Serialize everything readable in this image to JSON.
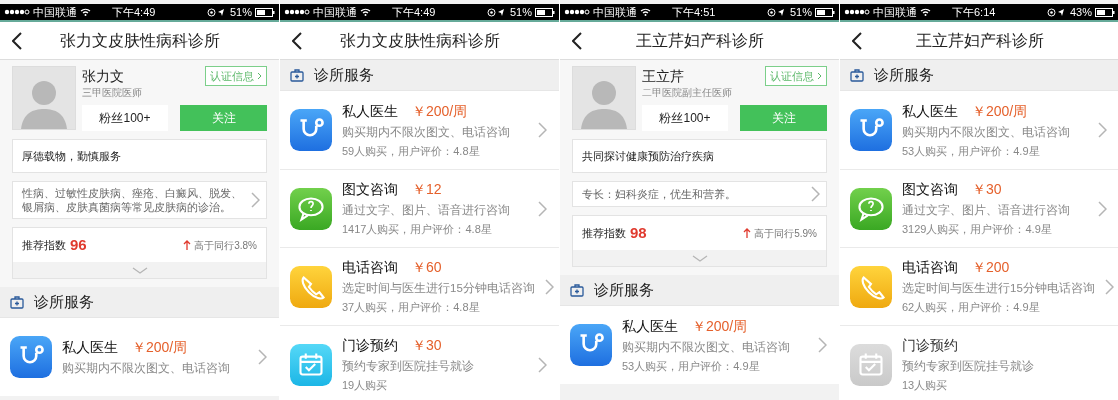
{
  "screens": [
    {
      "status_bar": {
        "carrier": "中国联通",
        "time": "下午4:49",
        "battery": "51%"
      },
      "nav": {
        "title": "张力文皮肤性病科诊所"
      },
      "doctor": {
        "name": "张力文",
        "title": "三甲医院医师",
        "verify": "认证信息",
        "fans": "粉丝100+",
        "follow": "关注",
        "motto": "厚德载物，勤慎服务",
        "specialty": "性病、过敏性皮肤病、痤疮、白癜风、脱发、银屑病、皮肤真菌病等常见皮肤病的诊治。",
        "rating_label": "推荐指数",
        "rating": "96",
        "compare": "高于同行3.8%"
      },
      "section": "诊所服务",
      "services": [
        {
          "kind": "doctor",
          "name": "私人医生",
          "price": "￥200/周",
          "desc": "购买期内不限次图文、电话咨询",
          "disabled": false
        }
      ]
    },
    {
      "status_bar": {
        "carrier": "中国联通",
        "time": "下午4:49",
        "battery": "51%"
      },
      "nav": {
        "title": "张力文皮肤性病科诊所"
      },
      "section": "诊所服务",
      "services": [
        {
          "kind": "doctor",
          "name": "私人医生",
          "price": "￥200/周",
          "desc": "购买期内不限次图文、电话咨询",
          "stats": "59人购买，用户评价：4.8星",
          "disabled": false
        },
        {
          "kind": "chat",
          "name": "图文咨询",
          "price": "￥12",
          "desc": "通过文字、图片、语音进行咨询",
          "stats": "1417人购买，用户评价：4.8星",
          "disabled": false
        },
        {
          "kind": "phone",
          "name": "电话咨询",
          "price": "￥60",
          "desc": "选定时间与医生进行15分钟电话咨询",
          "stats": "37人购买，用户评价：4.8星",
          "disabled": false
        },
        {
          "kind": "calendar",
          "name": "门诊预约",
          "price": "￥30",
          "desc": "预约专家到医院挂号就诊",
          "stats": "19人购买",
          "disabled": false
        }
      ]
    },
    {
      "status_bar": {
        "carrier": "中国联通",
        "time": "下午4:51",
        "battery": "51%"
      },
      "nav": {
        "title": "王立芹妇产科诊所"
      },
      "doctor": {
        "name": "王立芹",
        "title": "二甲医院副主任医师",
        "verify": "认证信息",
        "fans": "粉丝100+",
        "follow": "关注",
        "motto": "共同探讨健康预防治疗疾病",
        "specialty": "专长：妇科炎症，优生和营养。",
        "rating_label": "推荐指数",
        "rating": "98",
        "compare": "高于同行5.9%"
      },
      "section": "诊所服务",
      "services": [
        {
          "kind": "doctor",
          "name": "私人医生",
          "price": "￥200/周",
          "desc": "购买期内不限次图文、电话咨询",
          "stats": "53人购买，用户评价：4.9星",
          "disabled": false
        }
      ]
    },
    {
      "status_bar": {
        "carrier": "中国联通",
        "time": "下午6:14",
        "battery": "43%"
      },
      "nav": {
        "title": "王立芹妇产科诊所"
      },
      "section": "诊所服务",
      "services": [
        {
          "kind": "doctor",
          "name": "私人医生",
          "price": "￥200/周",
          "desc": "购买期内不限次图文、电话咨询",
          "stats": "53人购买，用户评价：4.9星",
          "disabled": false
        },
        {
          "kind": "chat",
          "name": "图文咨询",
          "price": "￥30",
          "desc": "通过文字、图片、语音进行咨询",
          "stats": "3129人购买，用户评价：4.9星",
          "disabled": false
        },
        {
          "kind": "phone",
          "name": "电话咨询",
          "price": "￥200",
          "desc": "选定时间与医生进行15分钟电话咨询",
          "stats": "62人购买，用户评价：4.9星",
          "disabled": false
        },
        {
          "kind": "calendar",
          "name": "门诊预约",
          "desc": "预约专家到医院挂号就诊",
          "stats": "13人购买",
          "disabled": true
        }
      ]
    }
  ]
}
